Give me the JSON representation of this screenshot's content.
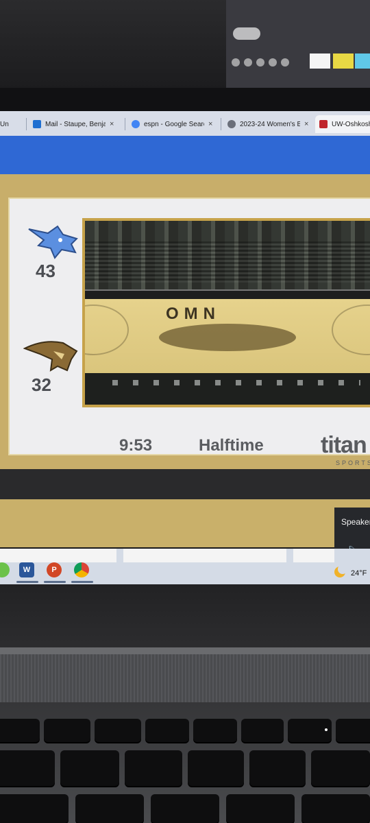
{
  "browser": {
    "tabs": [
      {
        "label": "Un",
        "favicon_color": "#6b6f7a"
      },
      {
        "label": "Mail - Staupe, Benjam",
        "favicon_color": "#1f6fd1"
      },
      {
        "label": "espn - Google Search",
        "favicon_color": "#4285f4"
      },
      {
        "label": "2023-24 Women's B",
        "favicon_color": "#6b6f7a"
      },
      {
        "label": "UW-Oshkosh",
        "favicon_color": "#c0262d"
      }
    ],
    "close_glyph": "×"
  },
  "scoreboard": {
    "home": {
      "score": "43",
      "logo": "blue-devil-logo-icon",
      "color": "#5b8fe0"
    },
    "away": {
      "score": "32",
      "logo": "titan-logo-icon",
      "color": "#8a6a35"
    },
    "clock": "9:53",
    "period": "Halftime",
    "brand": "titan",
    "brand_sub": "SPORTS",
    "court_text": "OMN"
  },
  "system": {
    "speaker_label": "Speaker",
    "speaker_icon": "volume-icon",
    "temperature": "24°F",
    "weather_icon": "moon-icon",
    "taskbar_apps": [
      {
        "name": "word",
        "glyph": "W",
        "color": "#2b579a"
      },
      {
        "name": "powerpoint",
        "glyph": "P",
        "color": "#d24726"
      },
      {
        "name": "chrome",
        "glyph": "",
        "color": "#e8a33a"
      }
    ]
  }
}
